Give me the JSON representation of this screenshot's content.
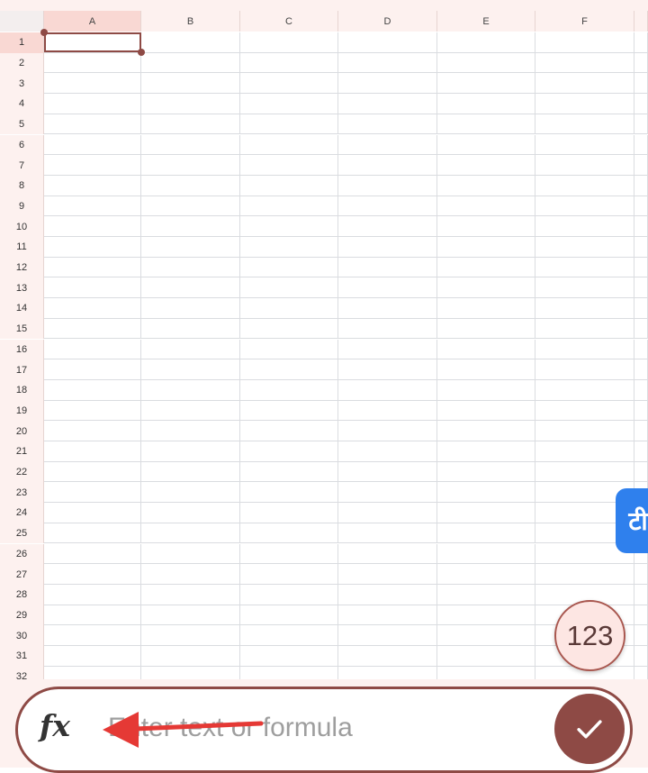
{
  "columns": [
    "A",
    "B",
    "C",
    "D",
    "E",
    "F"
  ],
  "rows": [
    "1",
    "2",
    "3",
    "4",
    "5",
    "6",
    "7",
    "8",
    "9",
    "10",
    "11",
    "12",
    "13",
    "14",
    "15",
    "16",
    "17",
    "18",
    "19",
    "20",
    "21",
    "22",
    "23",
    "24",
    "25",
    "26",
    "27",
    "28",
    "29",
    "30",
    "31",
    "32"
  ],
  "selected_cell": {
    "column": "A",
    "row": "1"
  },
  "number_keypad_button": {
    "label": "123"
  },
  "formula_bar": {
    "fx_label": "fx",
    "placeholder": "Enter text or formula",
    "value": ""
  },
  "confirm_button": {
    "icon": "check-icon"
  },
  "floating_app_button": {
    "glyph": "टी",
    "icon": "translator-app-icon"
  },
  "annotation": {
    "icon": "red-arrow-icon",
    "color": "#e53935"
  },
  "colors": {
    "accent": "#8e4a45",
    "header_bg": "#fdf1ef",
    "header_active": "#f9d8d3",
    "grid_line": "#dadce0"
  }
}
